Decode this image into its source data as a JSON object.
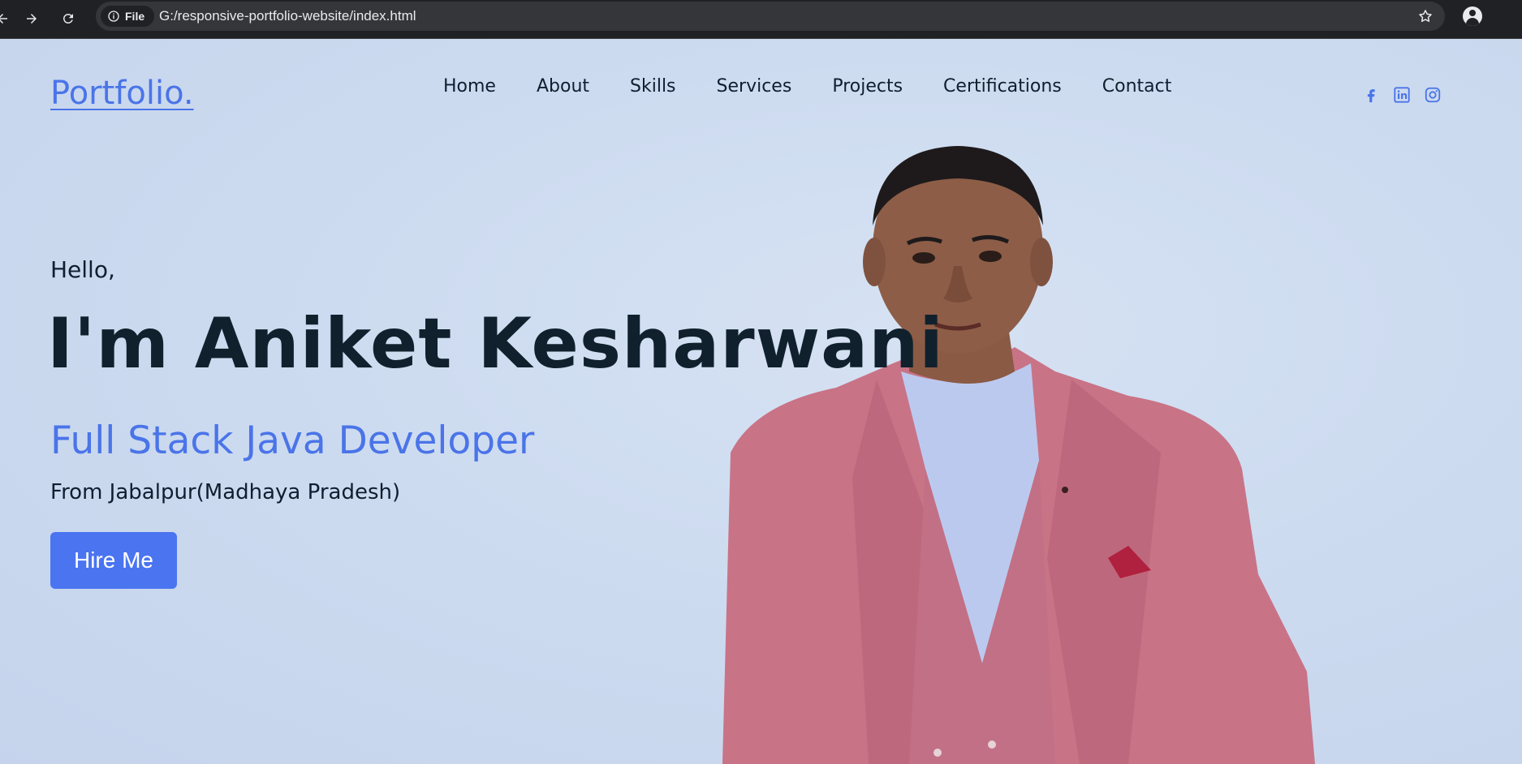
{
  "browser": {
    "site_chip_label": "File",
    "url": "G:/responsive-portfolio-website/index.html"
  },
  "header": {
    "logo": "Portfolio.",
    "nav": [
      {
        "label": "Home"
      },
      {
        "label": "About"
      },
      {
        "label": "Skills"
      },
      {
        "label": "Services"
      },
      {
        "label": "Projects"
      },
      {
        "label": "Certifications"
      },
      {
        "label": "Contact"
      }
    ],
    "social": [
      "facebook-icon",
      "linkedin-icon",
      "instagram-icon"
    ]
  },
  "hero": {
    "greeting": "Hello,",
    "name": "I'm Aniket Kesharwani",
    "role": "Full Stack Java Developer",
    "location": "From Jabalpur(Madhaya Pradesh)",
    "cta": "Hire Me"
  },
  "colors": {
    "accent": "#4a74e8",
    "button": "#4a74f0",
    "heading": "#10212d",
    "background": "#cddbf0",
    "browser_bar": "#202124",
    "jacket": "#c96f84"
  }
}
